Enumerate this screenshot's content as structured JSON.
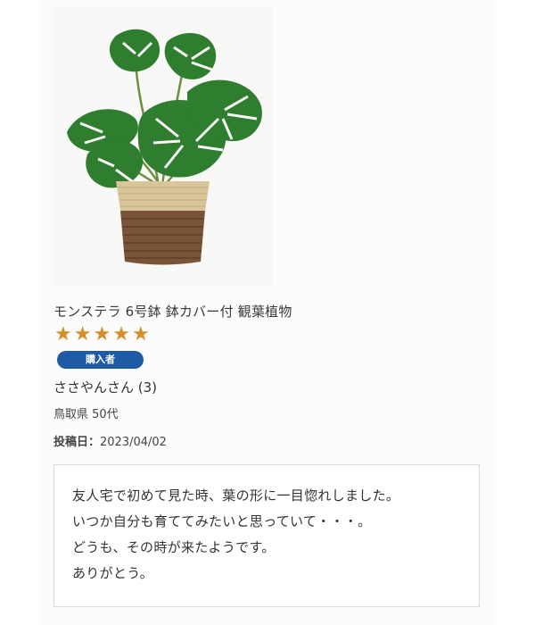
{
  "product": {
    "name": "モンステラ 6号鉢 鉢カバー付 観葉植物",
    "image_alt": "monstera-in-basket"
  },
  "rating": {
    "value": 5,
    "max": 5,
    "star_glyph": "★",
    "color": "#d58f2a"
  },
  "badge": {
    "label": "購入者",
    "color": "#1f5aa6"
  },
  "reviewer": {
    "nickname": "ささやんさん (3)",
    "region_age": "鳥取県 50代"
  },
  "post": {
    "label": "投稿日：",
    "date": "2023/04/02"
  },
  "comment": {
    "lines": [
      "友人宅で初めて見た時、葉の形に一目惚れしました。",
      "いつか自分も育ててみたいと思っていて・・・。",
      "どうも、その時が来たようです。",
      "ありがとう。"
    ]
  }
}
